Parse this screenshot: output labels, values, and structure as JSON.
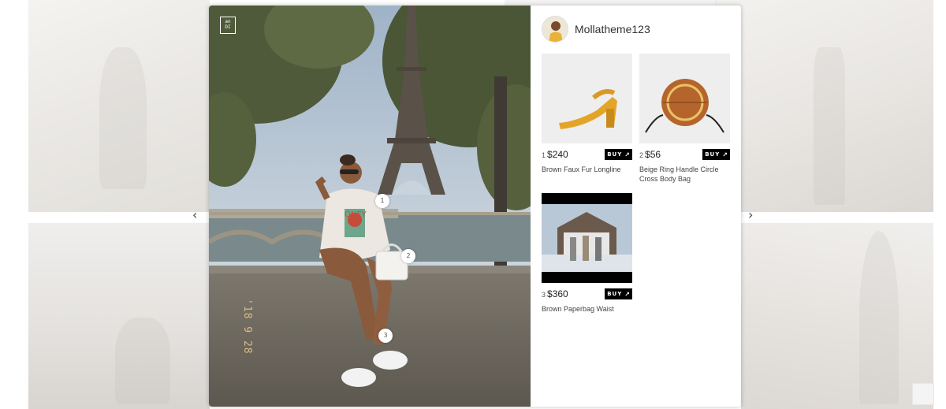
{
  "modal": {
    "photo": {
      "logo_text": "an\nDI",
      "hotspots": [
        "1",
        "2",
        "3"
      ],
      "datestamp": "'18 9 28"
    },
    "profile": {
      "username": "Mollatheme123"
    },
    "products": [
      {
        "number": "1",
        "price": "$240",
        "name": "Brown Faux Fur Longline",
        "buy_label": "BUY",
        "buy_icon": "↗"
      },
      {
        "number": "2",
        "price": "$56",
        "name": "Beige Ring Handle Circle Cross Body Bag",
        "buy_label": "BUY",
        "buy_icon": "↗"
      },
      {
        "number": "3",
        "price": "$360",
        "name": "Brown Paperbag Waist",
        "buy_label": "BUY",
        "buy_icon": "↗"
      }
    ]
  },
  "navigation": {
    "prev_icon": "‹",
    "next_icon": "›"
  },
  "colors": {
    "buy_bg": "#000000",
    "accent_text": "#333333"
  }
}
